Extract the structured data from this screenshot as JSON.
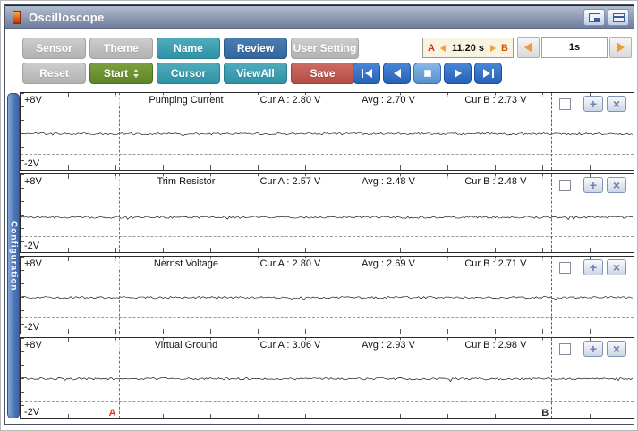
{
  "window": {
    "title": "Oscilloscope",
    "controls": {
      "restore": "restore-window-icon",
      "shade": "shade-window-icon"
    }
  },
  "toolbar": {
    "buttons_row1": [
      {
        "label": "Sensor",
        "variant": "gray"
      },
      {
        "label": "Theme",
        "variant": "gray"
      },
      {
        "label": "Name",
        "variant": "teal"
      },
      {
        "label": "Review",
        "variant": "blue"
      },
      {
        "label": "User Setting",
        "variant": "gray"
      }
    ],
    "buttons_row2": [
      {
        "label": "Reset",
        "variant": "gray"
      },
      {
        "label": "Start",
        "variant": "green",
        "spinner": "up-down-arrows"
      },
      {
        "label": "Cursor",
        "variant": "teal"
      },
      {
        "label": "ViewAll",
        "variant": "teal"
      },
      {
        "label": "Save",
        "variant": "red"
      }
    ],
    "playback": [
      "skip-to-start",
      "step-back",
      "stop",
      "play",
      "skip-to-end"
    ],
    "cursor_time": {
      "a": "A",
      "value": "11.20 s",
      "b": "B"
    },
    "time_scale": {
      "value": "1s"
    }
  },
  "sidebar": {
    "tab_label": "Configuration"
  },
  "cursors": {
    "a_label": "A",
    "b_label": "B",
    "a_color": "#e64433",
    "b_color": "#606060"
  },
  "icons": {
    "plus_glyph": "+",
    "close_glyph": "×"
  },
  "colors": {
    "teal": "#2e93a6",
    "blue": "#33679d",
    "green": "#5d8526",
    "red": "#b34d45",
    "gray": "#b2b2b2",
    "playback_blue": "#2563b8",
    "orange_arrow": "#f09a33",
    "config_tab": "#4a74b4"
  },
  "channels": [
    {
      "name": "Pumping Current",
      "cur_a": "Cur A : 2.80 V",
      "avg": "Avg : 2.70 V",
      "cur_b": "Cur B : 2.73 V",
      "ymax": "+8V",
      "ymin": "-2V",
      "avg_volts": 2.7,
      "vmax": 8,
      "vmin": -2
    },
    {
      "name": "Trim Resistor",
      "cur_a": "Cur A : 2.57 V",
      "avg": "Avg : 2.48 V",
      "cur_b": "Cur B : 2.48 V",
      "ymax": "+8V",
      "ymin": "-2V",
      "avg_volts": 2.48,
      "vmax": 8,
      "vmin": -2
    },
    {
      "name": "Nernst Voltage",
      "cur_a": "Cur A : 2.80 V",
      "avg": "Avg : 2.69 V",
      "cur_b": "Cur B : 2.71 V",
      "ymax": "+8V",
      "ymin": "-2V",
      "avg_volts": 2.69,
      "vmax": 8,
      "vmin": -2
    },
    {
      "name": "Virtual Ground",
      "cur_a": "Cur A : 3.06 V",
      "avg": "Avg : 2.93 V",
      "cur_b": "Cur B : 2.98 V",
      "ymax": "+8V",
      "ymin": "-2V",
      "avg_volts": 2.93,
      "vmax": 8,
      "vmin": -2
    }
  ]
}
